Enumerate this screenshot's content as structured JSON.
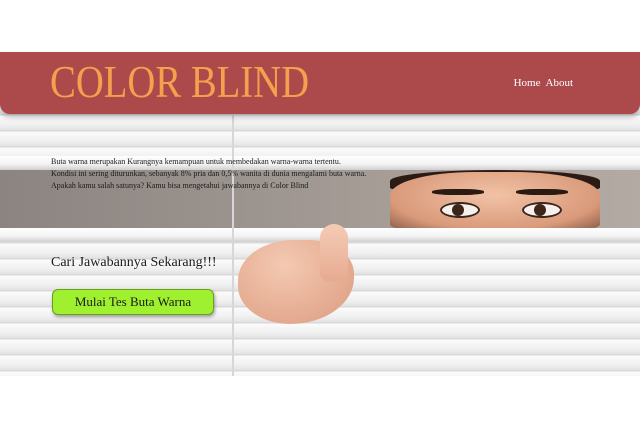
{
  "header": {
    "logo": "COLOR BLIND",
    "nav": [
      {
        "label": "Home"
      },
      {
        "label": "About"
      }
    ]
  },
  "intro": {
    "lines": [
      "Buta warna merupakan Kurangnya kemampuan untuk membedakan warna-warna tertentu.",
      "Kondisi ini sering diturunkan, sebanyak 8% pria dan 0,5% wanita di dunia mengalami buta warna.",
      "Apakah kamu salah satunya? Kamu bisa mengetahui jawabannya di Color Blind"
    ]
  },
  "cta": {
    "heading": "Cari Jawabannya Sekarang!!!",
    "button_label": "Mulai Tes Buta Warna"
  },
  "colors": {
    "header_bg": "#ac4a4b",
    "logo": "#f4a04e",
    "button_bg": "#9ff02e"
  }
}
